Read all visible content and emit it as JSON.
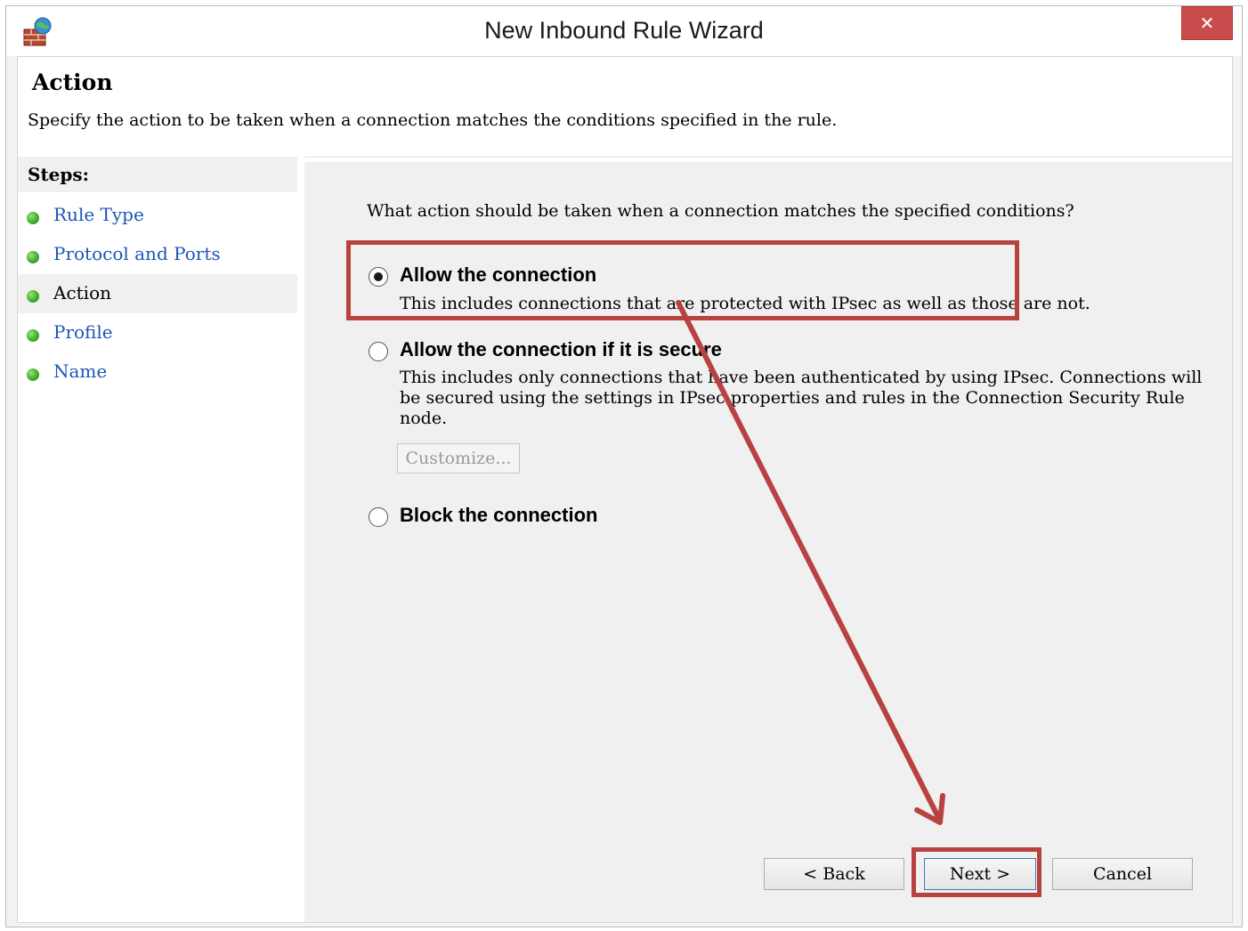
{
  "window": {
    "title": "New Inbound Rule Wizard",
    "close_glyph": "✕"
  },
  "header": {
    "title": "Action",
    "description": "Specify the action to be taken when a connection matches the conditions specified in the rule."
  },
  "steps": {
    "title": "Steps:",
    "items": [
      {
        "label": "Rule Type"
      },
      {
        "label": "Protocol and Ports"
      },
      {
        "label": "Action"
      },
      {
        "label": "Profile"
      },
      {
        "label": "Name"
      }
    ]
  },
  "content": {
    "question": "What action should be taken when a connection matches the specified conditions?",
    "options": [
      {
        "label": "Allow the connection",
        "description": "This includes connections that are protected with IPsec as well as those are not.",
        "selected": true
      },
      {
        "label": "Allow the connection if it is secure",
        "description_lines": [
          "This includes only connections that have been authenticated by using IPsec.  Connections will",
          "be secured using the settings in IPsec properties and rules in the Connection Security Rule",
          "node."
        ],
        "selected": false
      },
      {
        "label": "Block the connection",
        "selected": false
      }
    ],
    "customize_label": "Customize..."
  },
  "buttons": {
    "back_label": "< Back",
    "next_label": "Next >",
    "cancel_label": "Cancel"
  },
  "annotation": {
    "color": "#b8423f"
  },
  "icons": {
    "app": "firewall-icon",
    "close": "close-icon",
    "step": "green-bullet-icon"
  }
}
